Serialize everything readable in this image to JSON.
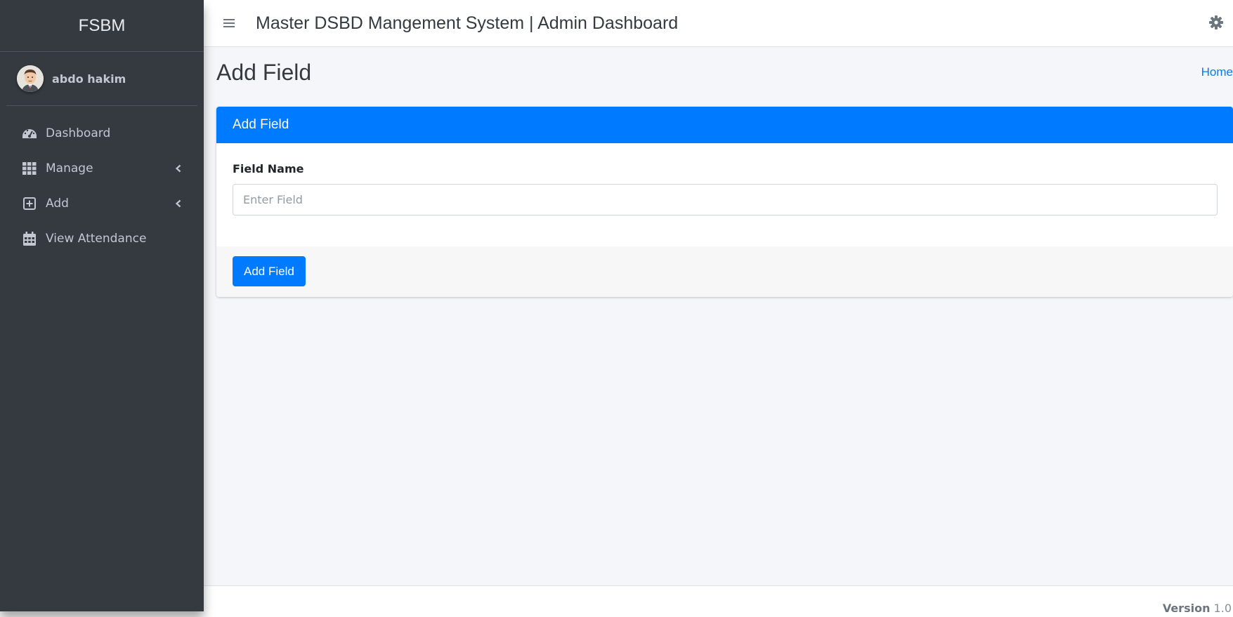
{
  "sidebar": {
    "brand": "FSBM",
    "user": {
      "name": "abdo hakim",
      "avatar_icon": "user-avatar"
    },
    "items": [
      {
        "label": "Dashboard",
        "icon": "tachometer-icon",
        "has_chevron": false
      },
      {
        "label": "Manage",
        "icon": "grid-icon",
        "has_chevron": true
      },
      {
        "label": "Add",
        "icon": "plus-square-icon",
        "has_chevron": true
      },
      {
        "label": "View Attendance",
        "icon": "calendar-icon",
        "has_chevron": false
      }
    ]
  },
  "navbar": {
    "title": "Master DSBD Mangement System | Admin Dashboard",
    "menu_icon": "bars-icon",
    "settings_icon": "gear-icon"
  },
  "content": {
    "page_title": "Add Field",
    "breadcrumb": {
      "home": "Home"
    }
  },
  "card": {
    "header": "Add Field",
    "field_label": "Field Name",
    "field_placeholder": "Enter Field",
    "field_value": "",
    "submit_label": "Add Field"
  },
  "footer": {
    "version_label": "Version",
    "version_number": "1.0"
  },
  "colors": {
    "primary": "#007bff",
    "sidebar_bg": "#343a40",
    "content_bg": "#f4f6f9"
  }
}
